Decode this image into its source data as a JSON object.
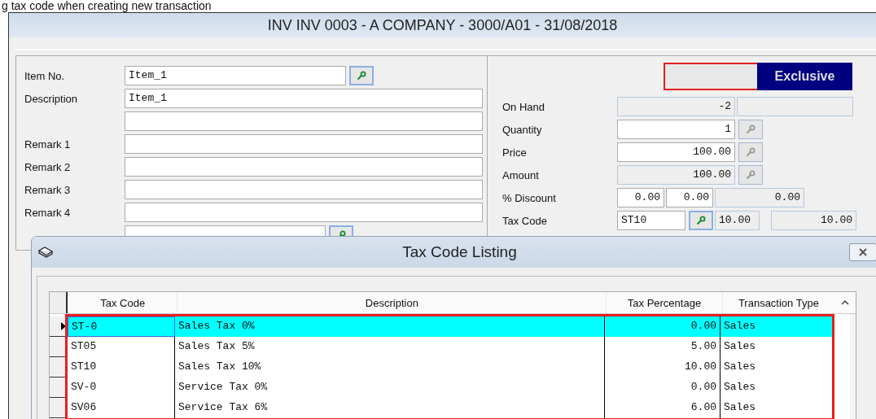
{
  "caption": "g tax code when creating new transaction",
  "window": {
    "title": "INV INV 0003 - A COMPANY - 3000/A01 - 31/08/2018"
  },
  "item_fields": [
    {
      "kind": "lookup",
      "label": "Item No.",
      "value": "Item_1"
    },
    {
      "kind": "text",
      "label": "Description",
      "value": "Item_1"
    },
    {
      "kind": "text"
    },
    {
      "kind": "text",
      "label": "Remark 1"
    },
    {
      "kind": "text",
      "label": "Remark 2"
    },
    {
      "kind": "text",
      "label": "Remark 3"
    },
    {
      "kind": "text",
      "label": "Remark 4"
    },
    {
      "kind": "lookup_short"
    }
  ],
  "tax_mode": {
    "label": "Exclusive"
  },
  "amount_fields": [
    {
      "kind": "onhand",
      "label": "On Hand",
      "value": "-2"
    },
    {
      "kind": "lookup",
      "label": "Quantity",
      "value": "1",
      "readonly": false
    },
    {
      "kind": "lookup",
      "label": "Price",
      "value": "100.00",
      "readonly": false
    },
    {
      "kind": "lookup",
      "label": "Amount",
      "value": "100.00",
      "readonly": true
    },
    {
      "kind": "discount",
      "label": "% Discount",
      "values": [
        "0.00",
        "0.00",
        "0.00"
      ]
    },
    {
      "kind": "taxcode",
      "label": "Tax Code",
      "code": "ST10",
      "rate": "10.00",
      "amount": "10.00"
    }
  ],
  "dialog": {
    "title": "Tax Code Listing",
    "columns": [
      "Tax Code",
      "Description",
      "Tax Percentage",
      "Transaction Type"
    ],
    "rows": [
      {
        "code": "ST-0",
        "description": "Sales Tax 0%",
        "percentage": "0.00",
        "type": "Sales",
        "selected": true
      },
      {
        "code": "ST05",
        "description": "Sales Tax 5%",
        "percentage": "5.00",
        "type": "Sales",
        "selected": false
      },
      {
        "code": "ST10",
        "description": "Sales Tax 10%",
        "percentage": "10.00",
        "type": "Sales",
        "selected": false
      },
      {
        "code": "SV-0",
        "description": "Service Tax 0%",
        "percentage": "0.00",
        "type": "Sales",
        "selected": false
      },
      {
        "code": "SV06",
        "description": "Service Tax 6%",
        "percentage": "6.00",
        "type": "Sales",
        "selected": false
      }
    ]
  }
}
